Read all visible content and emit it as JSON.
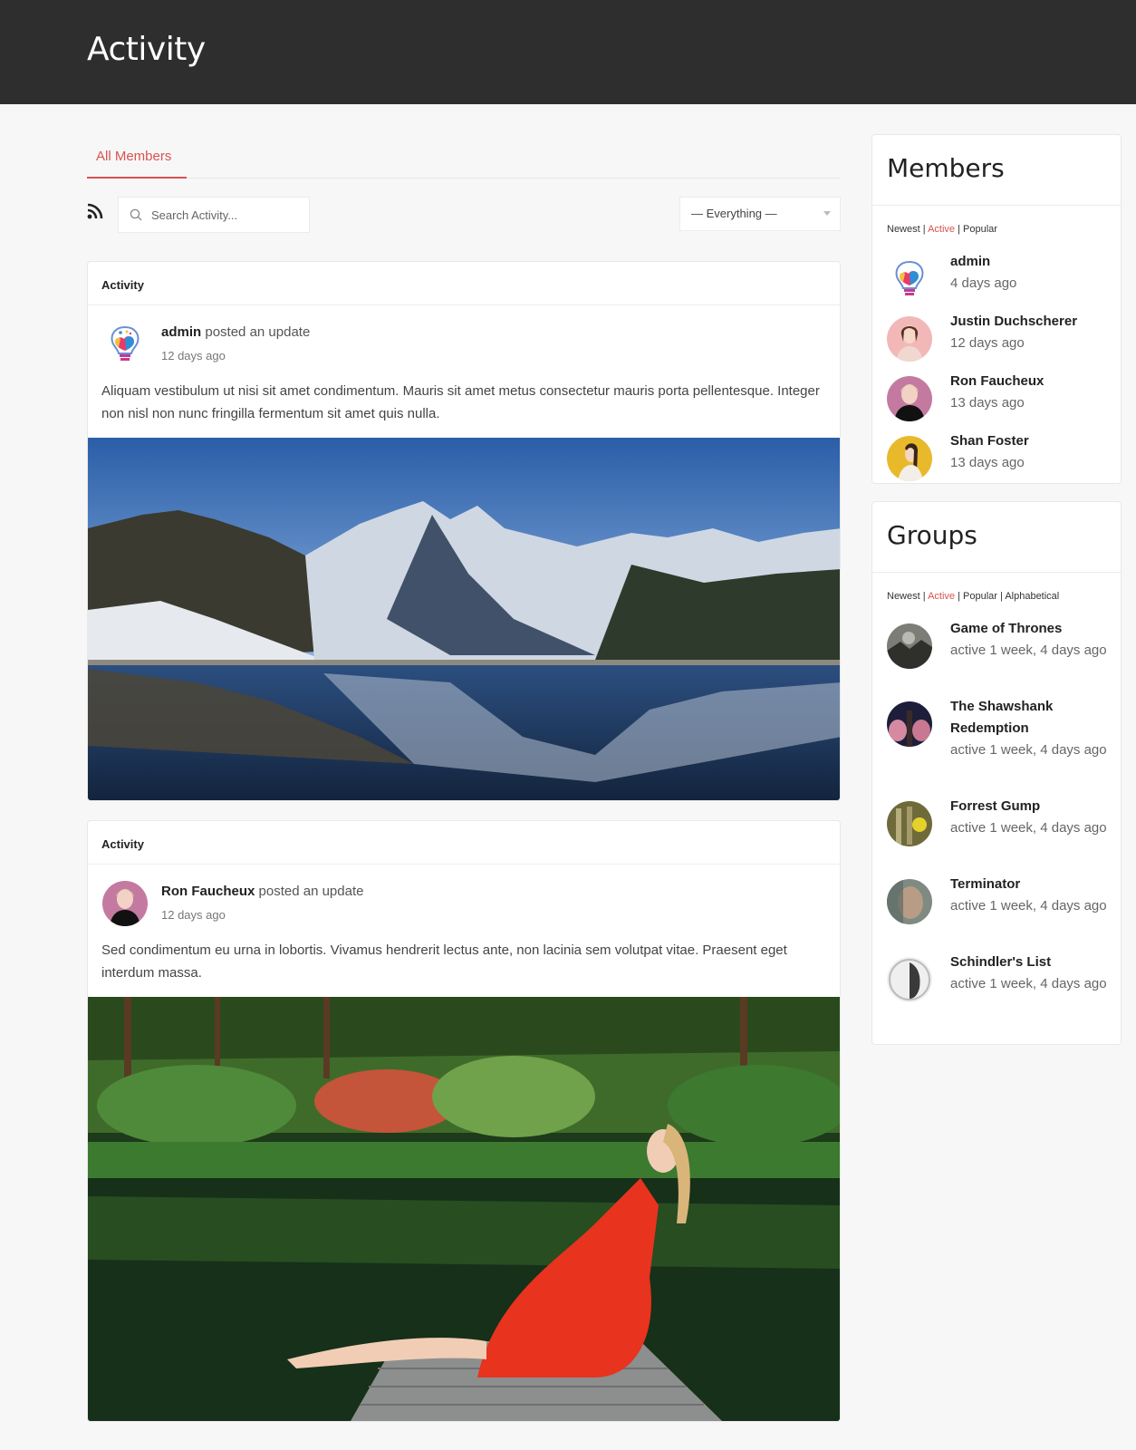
{
  "header": {
    "title": "Activity"
  },
  "tabs": [
    {
      "label": "All Members",
      "active": true
    }
  ],
  "toolbar": {
    "rss_icon": "rss-icon",
    "search": {
      "placeholder": "Search Activity...",
      "value": ""
    },
    "filter": {
      "selected": "— Everything —"
    }
  },
  "accent_color": "#d9534f",
  "feed": [
    {
      "section_label": "Activity",
      "author": "admin",
      "action": "posted an update",
      "time": "12 days ago",
      "avatar": "lightbulb-logo",
      "text": "Aliquam vestibulum ut nisi sit amet condimentum. Mauris sit amet metus consectetur mauris porta pellentesque. Integer non nisl non nunc fringilla fermentum sit amet quis nulla.",
      "image": "snowy mountains reflected in a lake"
    },
    {
      "section_label": "Activity",
      "author": "Ron Faucheux",
      "action": "posted an update",
      "time": "12 days ago",
      "avatar": "woman-portrait",
      "text": "Sed condimentum eu urna in lobortis. Vivamus hendrerit lectus ante, non lacinia sem volutpat vitae. Praesent eget interdum massa.",
      "image": "woman in red dress sitting on a dock by a pond"
    }
  ],
  "members_widget": {
    "title": "Members",
    "filters": [
      {
        "label": "Newest",
        "active": false
      },
      {
        "label": "Active",
        "active": true
      },
      {
        "label": "Popular",
        "active": false
      }
    ],
    "separator": "|",
    "items": [
      {
        "name": "admin",
        "time": "4 days ago"
      },
      {
        "name": "Justin Duchscherer",
        "time": "12 days ago"
      },
      {
        "name": "Ron Faucheux",
        "time": "13 days ago"
      },
      {
        "name": "Shan Foster",
        "time": "13 days ago"
      }
    ]
  },
  "groups_widget": {
    "title": "Groups",
    "filters": [
      {
        "label": "Newest",
        "active": false
      },
      {
        "label": "Active",
        "active": true
      },
      {
        "label": "Popular",
        "active": false
      },
      {
        "label": "Alphabetical",
        "active": false
      }
    ],
    "separator": "|",
    "items": [
      {
        "name": "Game of Thrones",
        "activity": "active 1 week, 4 days ago"
      },
      {
        "name": "The Shawshank Redemption",
        "activity": "active 1 week, 4 days ago"
      },
      {
        "name": "Forrest Gump",
        "activity": "active 1 week, 4 days ago"
      },
      {
        "name": "Terminator",
        "activity": "active 1 week, 4 days ago"
      },
      {
        "name": "Schindler's List",
        "activity": "active 1 week, 4 days ago"
      }
    ]
  }
}
